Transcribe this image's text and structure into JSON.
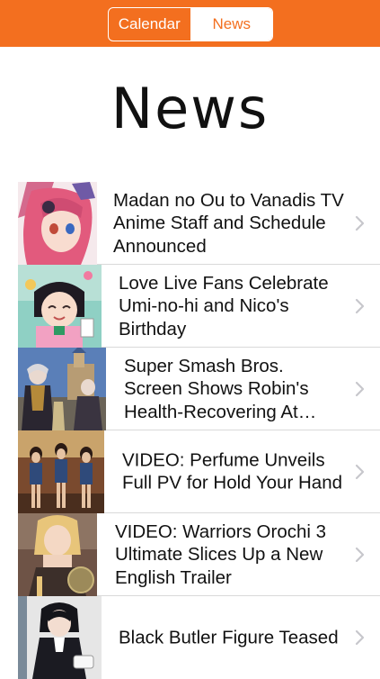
{
  "header": {
    "tabs": [
      {
        "label": "Calendar",
        "selected": false
      },
      {
        "label": "News",
        "selected": true
      }
    ],
    "accent_color": "#f36f1f"
  },
  "page": {
    "title": "News"
  },
  "news": [
    {
      "title": "Madan no Ou to Vanadis TV Anime Staff and Schedule Announced",
      "thumbnail": "anime-girl-pink-hair"
    },
    {
      "title": "Love Live Fans Celebrate Umi-no-hi and Nico's Birthday",
      "thumbnail": "anime-girl-black-hair"
    },
    {
      "title": "Super Smash Bros. Screen Shows Robin's Health-Recovering At…",
      "thumbnail": "game-characters-castle"
    },
    {
      "title": "VIDEO: Perfume Unveils Full PV for Hold Your Hand",
      "thumbnail": "three-performers-stage"
    },
    {
      "title": "VIDEO: Warriors Orochi 3 Ultimate Slices Up a New English Trailer",
      "thumbnail": "warrior-blonde-character"
    },
    {
      "title": "Black Butler Figure Teased",
      "thumbnail": "butler-figure"
    }
  ]
}
